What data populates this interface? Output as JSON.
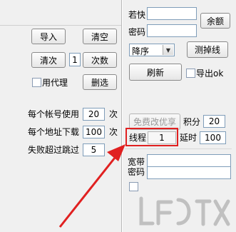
{
  "left_panel": {
    "import_label": "导入",
    "clear_label": "清空",
    "clear_times_label": "清次",
    "times_value": "1",
    "times_label": "次数",
    "use_proxy_label": "用代理",
    "delete_select_label": "删选",
    "per_account_use_label": "每个帐号使用",
    "per_account_use_value": "20",
    "per_account_unit": "次",
    "per_address_download_label": "每个地址下载",
    "per_address_download_value": "100",
    "per_address_unit": "次",
    "fail_skip_label": "失败超过跳过",
    "fail_skip_value": "5"
  },
  "right_panel": {
    "ruokuai_label": "若快",
    "ruokuai_value": "",
    "balance_label": "余额",
    "password_label": "密码",
    "password_value": "",
    "sort_selected": "降序",
    "test_label": "测掉线",
    "refresh_label": "刷新",
    "export_ok_label": "导出ok",
    "free_upgrade_label": "免费改优享",
    "points_label": "积分",
    "points_value": "20",
    "threads_label": "线程",
    "threads_value": "1",
    "delay_label": "延时",
    "delay_value": "100",
    "broadband_label": "宽带",
    "broadband_value": "",
    "password2_label": "密码",
    "password2_value": ""
  },
  "icons": {
    "dropdown_arrow": "chevron-down-icon",
    "annotation_arrow": "red-arrow-icon"
  },
  "colors": {
    "annotation_red": "#e02020"
  }
}
